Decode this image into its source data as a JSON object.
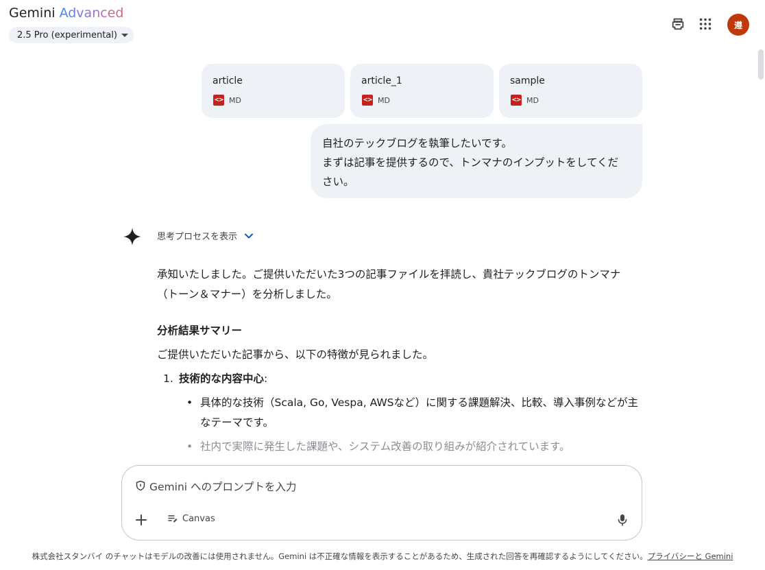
{
  "header": {
    "brand_main": "Gemini",
    "brand_sub": "Advanced",
    "model_label": "2.5 Pro (experimental)",
    "avatar_initial": "遵",
    "avatar_color": "#c0390b"
  },
  "attachments": [
    {
      "name": "article",
      "type": "MD",
      "icon": "code-file-icon"
    },
    {
      "name": "article_1",
      "type": "MD",
      "icon": "code-file-icon"
    },
    {
      "name": "sample",
      "type": "MD",
      "icon": "code-file-icon"
    }
  ],
  "user_message": {
    "line1": "自社のテックブログを執筆したいです。",
    "line2": "まずは記事を提供するので、トンマナのインプットをしてくだ",
    "line3": "さい。"
  },
  "response": {
    "thoughts_label": "思考プロセスを表示",
    "intro_line1": "承知いたしました。ご提供いただいた3つの記事ファイルを拝読し、貴社テックブログのトンマナ",
    "intro_line2": "（トーン＆マナー）を分析しました。",
    "heading": "分析結果サマリー",
    "lead": "ご提供いただいた記事から、以下の特徴が見られました。",
    "list_item1_num": "1.",
    "list_item1_title": "技術的な内容中心",
    "list_item1_colon": ":",
    "bullet1": "具体的な技術（Scala, Go, Vespa, AWSなど）に関する課題解決、比較、導入事例などが主なテーマです。",
    "bullet2": "社内で実際に発生した課題や、システム改善の取り組みが紹介されています。"
  },
  "composer": {
    "placeholder": "Gemini へのプロンプトを入力",
    "canvas_label": "Canvas"
  },
  "footer": {
    "text": "株式会社スタンバイ のチャットはモデルの改善には使用されません。Gemini は不正確な情報を表示することがあるため、生成された回答を再確認するようにしてください。",
    "link": "プライバシーと Gemini"
  },
  "colors": {
    "bubble_bg": "#eef1f6",
    "file_icon_red": "#c5221f",
    "accent_blue": "#0b57d0"
  }
}
